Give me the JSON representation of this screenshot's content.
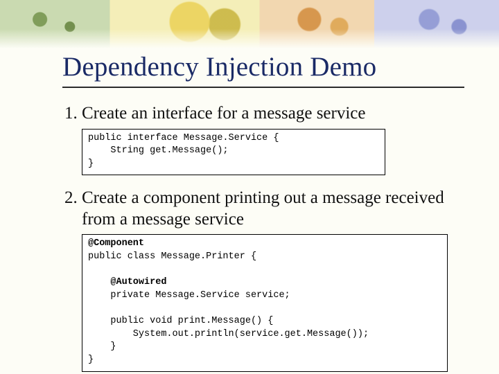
{
  "title": "Dependency Injection Demo",
  "steps": [
    {
      "text": "Create an interface for a message service",
      "code": "public interface Message.Service {\n    String get.Message();\n}"
    },
    {
      "text": "Create a component printing out a message received from a message service",
      "code": "@Component\npublic class Message.Printer {\n\n    @Autowired\n    private Message.Service service;\n\n    public void print.Message() {\n        System.out.println(service.get.Message());\n    }\n}"
    }
  ],
  "highlight_keywords": [
    "@Component",
    "@Autowired"
  ]
}
